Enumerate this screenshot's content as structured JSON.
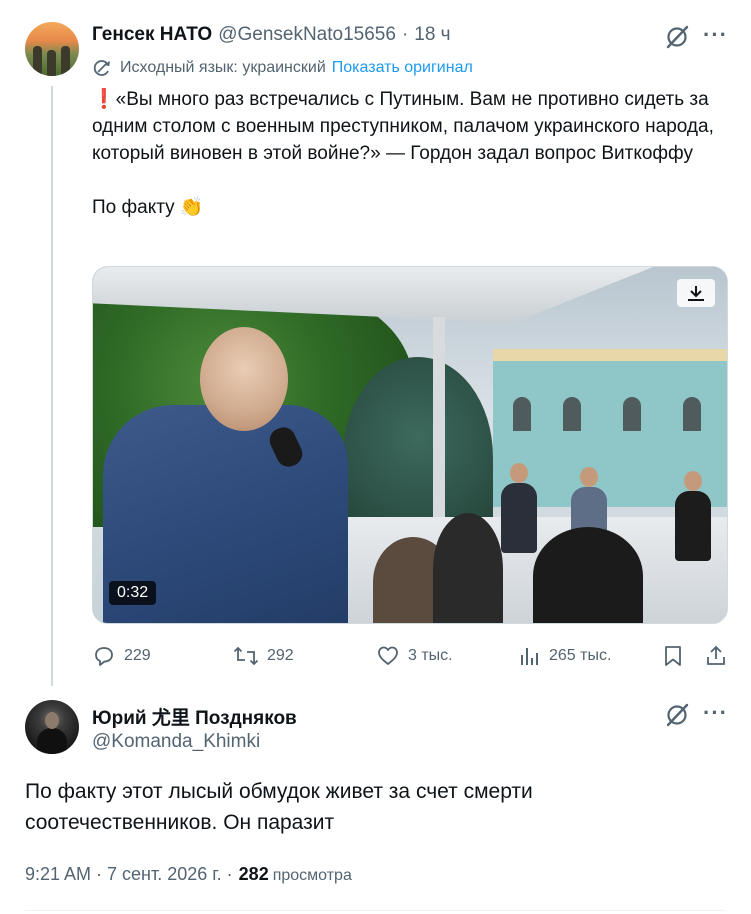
{
  "tweet": {
    "author_name": "Генсек НАТО",
    "handle": "@GensekNato15656",
    "separator": "·",
    "time": "18 ч",
    "translation_note": "Исходный язык: украинский",
    "show_original": "Показать оригинал",
    "text_line1": "«Вы много раз встречались с Путиным. Вам не противно сидеть за одним столом с военным преступником, палачом украинского народа, который виновен в этой войне?» — Гордон задал вопрос Виткоффу",
    "exclamation": "❗",
    "text_line2": "По факту 👏",
    "media": {
      "duration": "0:32"
    },
    "stats": {
      "replies": "229",
      "reposts": "292",
      "likes": "3 тыс.",
      "views": "265 тыс."
    }
  },
  "reply": {
    "author_name": "Юрий 尤里 Поздняков",
    "handle": "@Komanda_Khimki",
    "text": "По факту этот лысый обмудок живет за счет смерти соотечественников. Он паразит",
    "timestamp": "9:21 AM · 7 сент. 2026 г. ·",
    "views_count": "282",
    "views_label": "просмотра"
  },
  "icons": {
    "grok": "grok-icon",
    "more": "more-icon",
    "translate": "translate-icon",
    "reply": "reply-icon",
    "repost": "repost-icon",
    "like": "heart-icon",
    "views": "analytics-icon",
    "bookmark": "bookmark-icon",
    "share": "share-icon",
    "download": "download-icon"
  },
  "colors": {
    "accent": "#1d9bf0",
    "secondary_text": "#536471",
    "primary_text": "#0f1419"
  }
}
